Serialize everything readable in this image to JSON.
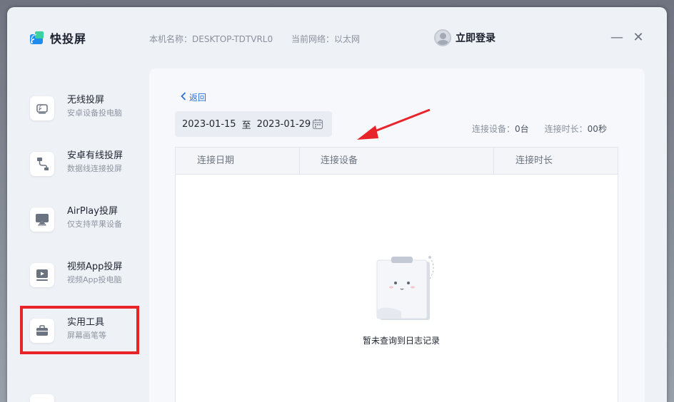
{
  "app": {
    "name": "快投屏",
    "host_label": "本机名称：DESKTOP-TDTVRL0",
    "network_label": "当前网络：以太网",
    "login_label": "立即登录",
    "minimize_symbol": "—",
    "close_symbol": "✕"
  },
  "sidebar": {
    "items": [
      {
        "title": "无线投屏",
        "subtitle": "安卓设备投电脑",
        "icon": "wireless-cast-icon"
      },
      {
        "title": "安卓有线投屏",
        "subtitle": "数据线连接投屏",
        "icon": "usb-cable-icon"
      },
      {
        "title": "AirPlay投屏",
        "subtitle": "仅支持苹果设备",
        "icon": "airplay-icon"
      },
      {
        "title": "视频App投屏",
        "subtitle": "视频App投电脑",
        "icon": "video-app-icon"
      },
      {
        "title": "实用工具",
        "subtitle": "屏幕画笔等",
        "icon": "toolbox-icon"
      }
    ]
  },
  "main": {
    "back_label": "返回",
    "date_start": "2023-01-15",
    "date_separator": "至",
    "date_end": "2023-01-29",
    "stats": {
      "devices_label": "连接设备：",
      "devices_value": "0台",
      "duration_label": "连接时长：",
      "duration_value": "00秒"
    },
    "table": {
      "headers": [
        "连接日期",
        "连接设备",
        "连接时长"
      ],
      "empty_text": "暂未查询到日志记录"
    }
  },
  "colors": {
    "accent": "#2b6fd8",
    "highlight_box": "#e8232a",
    "annotation_arrow": "#e8232a"
  }
}
